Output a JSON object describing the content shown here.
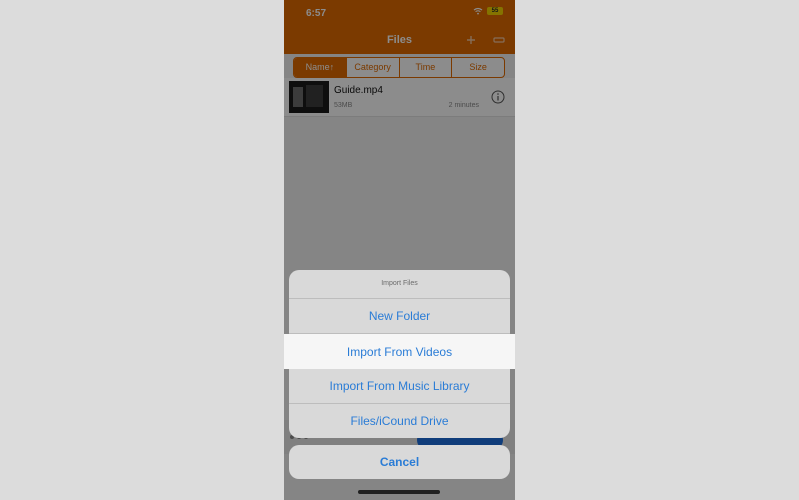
{
  "status": {
    "time": "6:57",
    "battery": "55"
  },
  "navbar": {
    "title": "Files"
  },
  "segments": [
    "Name↑",
    "Category",
    "Time",
    "Size"
  ],
  "file": {
    "name": "Guide.mp4",
    "size": "53MB",
    "date": "2 minutes"
  },
  "sheet": {
    "title": "Import Files",
    "actions": [
      "New Folder",
      "Import From Videos",
      "Import From Music Library",
      "Files/iCound Drive"
    ]
  },
  "cancel_label": "Cancel",
  "colors": {
    "accent": "#e06a00",
    "ios_blue": "#2a7cd6"
  }
}
